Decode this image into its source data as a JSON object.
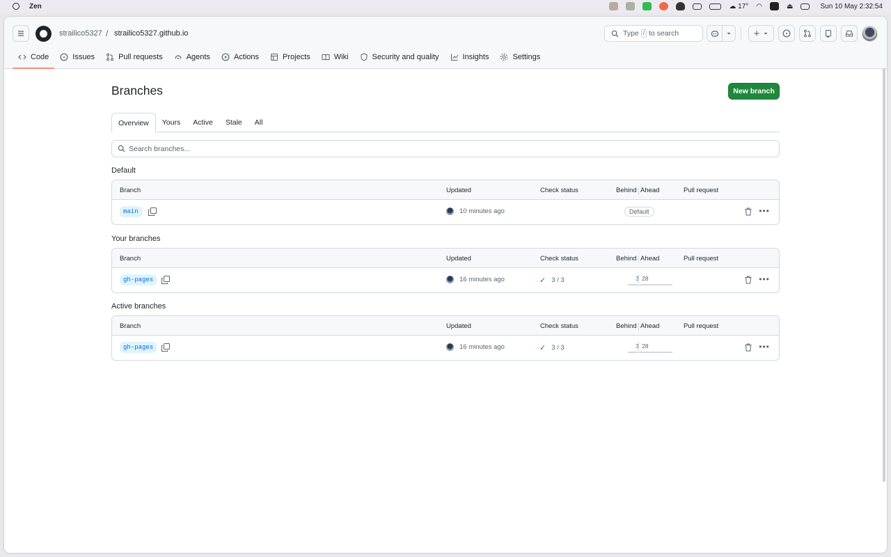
{
  "menubar": {
    "app_name": "Zen",
    "temperature": "17°",
    "clock": "Sun 10 May  2:32:54"
  },
  "header": {
    "owner": "strailico5327",
    "separator": "/",
    "repo": "strailico5327.github.io",
    "search_prefix": "Type",
    "search_key": "/",
    "search_suffix": "to search"
  },
  "repo_nav": [
    {
      "label": "Code",
      "icon": "code-icon",
      "selected": true
    },
    {
      "label": "Issues",
      "icon": "issue-icon"
    },
    {
      "label": "Pull requests",
      "icon": "pull-request-icon"
    },
    {
      "label": "Agents",
      "icon": "agents-icon"
    },
    {
      "label": "Actions",
      "icon": "play-icon"
    },
    {
      "label": "Projects",
      "icon": "table-icon"
    },
    {
      "label": "Wiki",
      "icon": "book-icon"
    },
    {
      "label": "Security and quality",
      "icon": "shield-icon"
    },
    {
      "label": "Insights",
      "icon": "graph-icon"
    },
    {
      "label": "Settings",
      "icon": "gear-icon"
    }
  ],
  "page": {
    "title": "Branches",
    "new_branch_label": "New branch",
    "tabs": [
      "Overview",
      "Yours",
      "Active",
      "Stale",
      "All"
    ],
    "active_tab": "Overview",
    "search_placeholder": "Search branches..."
  },
  "columns": {
    "branch": "Branch",
    "updated": "Updated",
    "check_status": "Check status",
    "behind": "Behind",
    "ahead": "Ahead",
    "pull_request": "Pull request"
  },
  "sections": {
    "default": {
      "title": "Default",
      "row": {
        "branch": "main",
        "updated": "10 minutes ago",
        "badge": "Default"
      }
    },
    "yours": {
      "title": "Your branches",
      "row": {
        "branch": "gh-pages",
        "updated": "16 minutes ago",
        "check": "3 / 3",
        "behind": "3",
        "ahead": "28"
      }
    },
    "active": {
      "title": "Active branches",
      "row": {
        "branch": "gh-pages",
        "updated": "16 minutes ago",
        "check": "3 / 3",
        "behind": "3",
        "ahead": "28"
      }
    }
  },
  "colors": {
    "accent_green": "#1f883d",
    "nav_underline": "#fd8c73",
    "branch_label_bg": "#ddf4ff",
    "branch_label_fg": "#0969da"
  }
}
